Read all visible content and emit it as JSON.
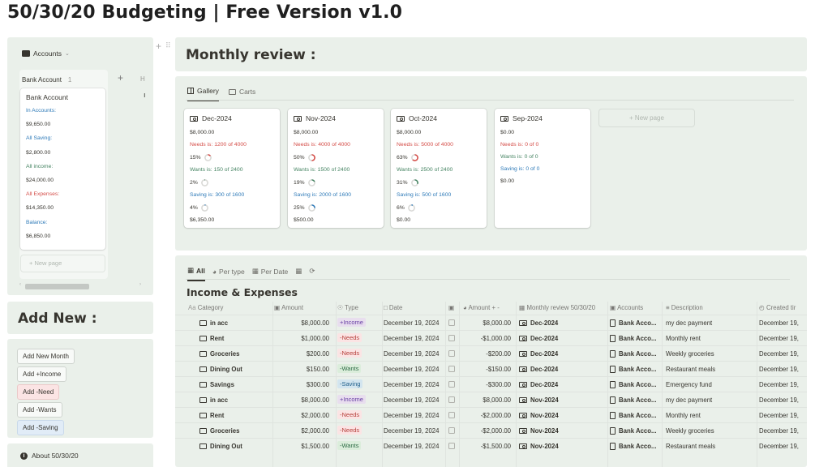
{
  "page": {
    "title": "50/30/20 Budgeting | Free Version v1.0"
  },
  "accounts": {
    "toggle_label": "Accounts",
    "group_name": "Bank Account",
    "group_count": "1",
    "plus": "+",
    "hidden_col": "H",
    "card": {
      "title": "Bank Account",
      "lines": [
        {
          "text": "In Accounts:",
          "color": "blue"
        },
        {
          "text": "$9,650.00",
          "color": "gray"
        },
        {
          "text": "All Saving:",
          "color": "blue"
        },
        {
          "text": "$2,800.00",
          "color": "gray"
        },
        {
          "text": "All income:",
          "color": "green"
        },
        {
          "text": "$24,000.00",
          "color": "gray"
        },
        {
          "text": "All Expenses:",
          "color": "red"
        },
        {
          "text": "$14,350.00",
          "color": "gray"
        },
        {
          "text": "Balance:",
          "color": "blue"
        },
        {
          "text": "$6,850.00",
          "color": "gray"
        }
      ]
    },
    "new_page": "+  New page"
  },
  "add_new": {
    "title": "Add New :",
    "buttons": [
      "Add New Month",
      "Add +Income",
      "Add -Need",
      "Add -Wants",
      "Add -Saving"
    ]
  },
  "about": {
    "label": "About 50/30/20"
  },
  "monthly_review": {
    "title": "Monthly review :",
    "tabs": [
      "Gallery",
      "Carts"
    ],
    "new_page": "+  New page",
    "cards": [
      {
        "title": "Dec-2024",
        "total": "$8,000.00",
        "needs": "Needs is: 1200 of 4000",
        "needs_pct": "15%",
        "wants": "Wants is: 150 of 2400",
        "wants_pct": "2%",
        "saving": "Saving is: 300 of 1600",
        "saving_pct": "4%",
        "remaining": "$6,350.00"
      },
      {
        "title": "Nov-2024",
        "total": "$8,000.00",
        "needs": "Needs is: 4000 of 4000",
        "needs_pct": "50%",
        "wants": "Wants is: 1500 of 2400",
        "wants_pct": "19%",
        "saving": "Saving is: 2000 of 1600",
        "saving_pct": "25%",
        "remaining": "$500.00"
      },
      {
        "title": "Oct-2024",
        "total": "$8,000.00",
        "needs": "Needs is: 5000 of 4000",
        "needs_pct": "63%",
        "wants": "Wants is: 2500 of 2400",
        "wants_pct": "31%",
        "saving": "Saving is: 500 of 1600",
        "saving_pct": "6%",
        "remaining": "$0.00"
      },
      {
        "title": "Sep-2024",
        "total": "$0.00",
        "needs": "Needs is: 0 of 0",
        "wants": "Wants is: 0 of 0",
        "saving": "Saving is: 0 of 0",
        "remaining": "$0.00"
      }
    ]
  },
  "income_expenses": {
    "tabs": [
      "All",
      "Per type",
      "Per Date"
    ],
    "title": "Income & Expenses",
    "columns": [
      "Category",
      "Amount",
      "Type",
      "Date",
      "Amount + -",
      "Monthly review 50/30/20",
      "Accounts",
      "Description",
      "Created tir"
    ],
    "rows": [
      {
        "category": "in acc",
        "amount": "$8,000.00",
        "type": "+Income",
        "date": "December 19, 2024",
        "signed": "$8,000.00",
        "month": "Dec-2024",
        "account": "Bank Acco...",
        "description": "my dec payment",
        "created": "December 19,"
      },
      {
        "category": "Rent",
        "amount": "$1,000.00",
        "type": "-Needs",
        "date": "December 19, 2024",
        "signed": "-$1,000.00",
        "month": "Dec-2024",
        "account": "Bank Acco...",
        "description": "Monthly rent",
        "created": "December 19,"
      },
      {
        "category": "Groceries",
        "amount": "$200.00",
        "type": "-Needs",
        "date": "December 19, 2024",
        "signed": "-$200.00",
        "month": "Dec-2024",
        "account": "Bank Acco...",
        "description": "Weekly groceries",
        "created": "December 19,"
      },
      {
        "category": "Dining Out",
        "amount": "$150.00",
        "type": "-Wants",
        "date": "December 19, 2024",
        "signed": "-$150.00",
        "month": "Dec-2024",
        "account": "Bank Acco...",
        "description": "Restaurant meals",
        "created": "December 19,"
      },
      {
        "category": "Savings",
        "amount": "$300.00",
        "type": "-Saving",
        "date": "December 19, 2024",
        "signed": "-$300.00",
        "month": "Dec-2024",
        "account": "Bank Acco...",
        "description": "Emergency fund",
        "created": "December 19,"
      },
      {
        "category": "in acc",
        "amount": "$8,000.00",
        "type": "+Income",
        "date": "December 19, 2024",
        "signed": "$8,000.00",
        "month": "Nov-2024",
        "account": "Bank Acco...",
        "description": "my dec payment",
        "created": "December 19,"
      },
      {
        "category": "Rent",
        "amount": "$2,000.00",
        "type": "-Needs",
        "date": "December 19, 2024",
        "signed": "-$2,000.00",
        "month": "Nov-2024",
        "account": "Bank Acco...",
        "description": "Monthly rent",
        "created": "December 19,"
      },
      {
        "category": "Groceries",
        "amount": "$2,000.00",
        "type": "-Needs",
        "date": "December 19, 2024",
        "signed": "-$2,000.00",
        "month": "Nov-2024",
        "account": "Bank Acco...",
        "description": "Weekly groceries",
        "created": "December 19,"
      },
      {
        "category": "Dining Out",
        "amount": "$1,500.00",
        "type": "-Wants",
        "date": "December 19, 2024",
        "signed": "-$1,500.00",
        "month": "Nov-2024",
        "account": "Bank Acco...",
        "description": "Restaurant meals",
        "created": "December 19,"
      }
    ]
  },
  "colors": {
    "panel_bg": "#eaf0ea",
    "needs_red": "#d44c47",
    "wants_green": "#448361",
    "saving_blue": "#2e7ab8"
  }
}
